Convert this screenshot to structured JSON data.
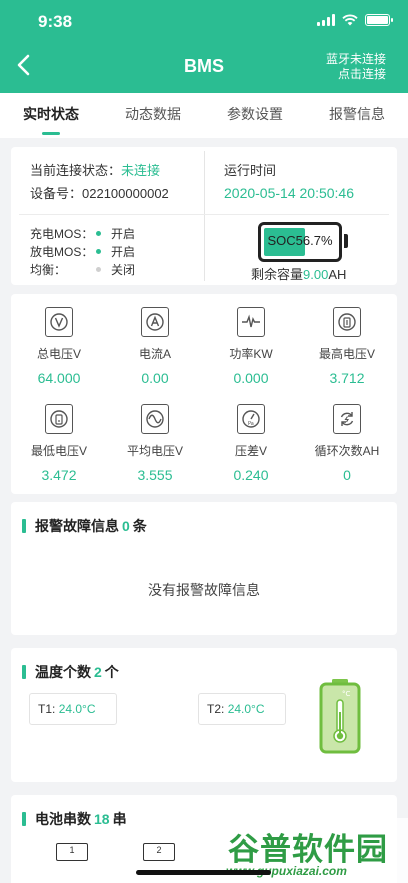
{
  "status_bar": {
    "time": "9:38"
  },
  "nav": {
    "title": "BMS",
    "bt_line1": "蓝牙未连接",
    "bt_line2": "点击连接"
  },
  "tabs": [
    "实时状态",
    "动态数据",
    "参数设置",
    "报警信息"
  ],
  "status": {
    "conn_label": "当前连接状态：",
    "conn_value": "未连接",
    "device_label": "设备号：",
    "device_value": "022100000002",
    "runtime_label": "运行时间",
    "runtime_value": "2020-05-14 20:50:46",
    "mos": [
      {
        "label": "充电MOS：",
        "value": "开启",
        "on": true
      },
      {
        "label": "放电MOS：",
        "value": "开启",
        "on": true
      },
      {
        "label": "均衡：",
        "value": "关闭",
        "on": false
      }
    ],
    "soc_text": "SOC56.7%",
    "soc_fraction": 0.567,
    "remain_label": "剩余容量",
    "remain_value": "9.00",
    "remain_unit": "AH"
  },
  "metrics": [
    {
      "label": "总电压V",
      "value": "64.000",
      "icon": "voltmeter-icon"
    },
    {
      "label": "电流A",
      "value": "0.00",
      "icon": "ammeter-icon"
    },
    {
      "label": "功率KW",
      "value": "0.000",
      "icon": "power-wave-icon"
    },
    {
      "label": "最高电压V",
      "value": "3.712",
      "icon": "max-voltage-icon"
    },
    {
      "label": "最低电压V",
      "value": "3.472",
      "icon": "min-voltage-icon"
    },
    {
      "label": "平均电压V",
      "value": "3.555",
      "icon": "sine-wave-icon"
    },
    {
      "label": "压差V",
      "value": "0.240",
      "icon": "pressure-gauge-icon"
    },
    {
      "label": "循环次数AH",
      "value": "0",
      "icon": "cycle-icon"
    }
  ],
  "alarm": {
    "title": "报警故障信息",
    "count": "0",
    "unit": "条",
    "empty_text": "没有报警故障信息"
  },
  "temperature": {
    "title": "温度个数",
    "count": "2",
    "unit": "个",
    "sensors": [
      {
        "label": "T1:",
        "value": "24.0°C"
      },
      {
        "label": "T2:",
        "value": "24.0°C"
      }
    ],
    "thermo_unit": "°C"
  },
  "cells": {
    "title": "电池串数",
    "count": "18",
    "unit": "串",
    "visible_cells": [
      "1",
      "2"
    ]
  },
  "watermark": {
    "main": "谷普软件园",
    "url": "www.gupuxiazai.com"
  },
  "colors": {
    "accent": "#2bbd92",
    "header": "#2bbd92",
    "watermark": "#2f9c45"
  }
}
